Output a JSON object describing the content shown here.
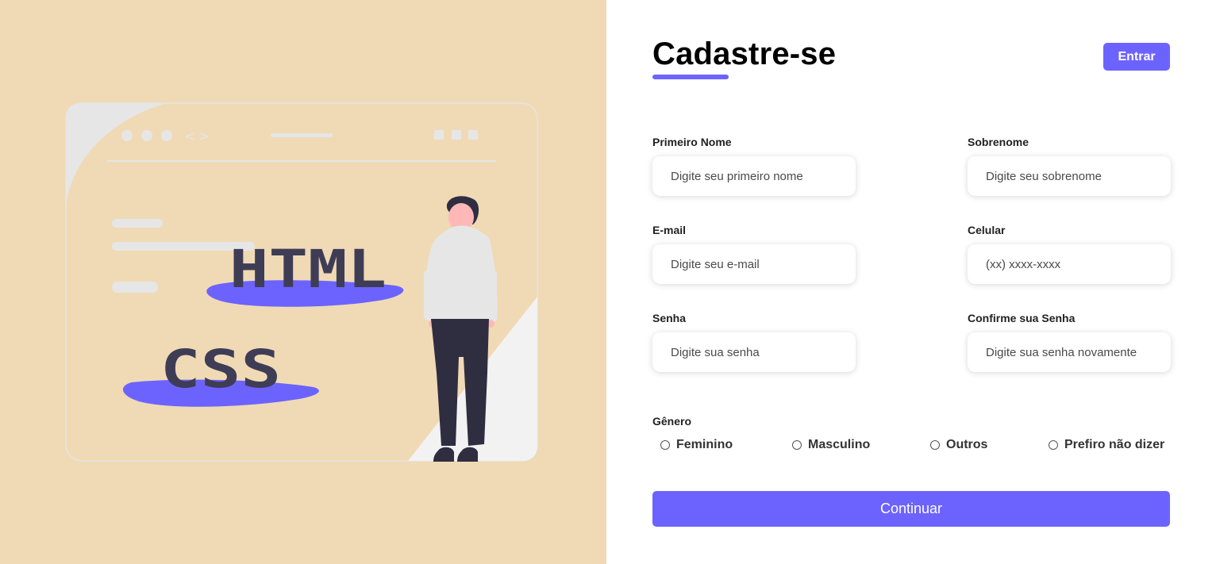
{
  "header": {
    "title": "Cadastre-se",
    "login_label": "Entrar"
  },
  "illustration": {
    "html_text": "HTML",
    "css_text": "CSS",
    "code_glyph": "< >"
  },
  "form": {
    "fields": [
      {
        "label": "Primeiro Nome",
        "placeholder": "Digite seu primeiro nome"
      },
      {
        "label": "Sobrenome",
        "placeholder": "Digite seu sobrenome"
      },
      {
        "label": "E-mail",
        "placeholder": "Digite seu e-mail"
      },
      {
        "label": "Celular",
        "placeholder": "(xx) xxxx-xxxx"
      },
      {
        "label": "Senha",
        "placeholder": "Digite sua senha"
      },
      {
        "label": "Confirme sua Senha",
        "placeholder": "Digite sua senha novamente"
      }
    ],
    "gender": {
      "title": "Gênero",
      "options": [
        "Feminino",
        "Masculino",
        "Outros",
        "Prefiro não dizer"
      ]
    },
    "submit_label": "Continuar"
  },
  "colors": {
    "accent": "#6c63ff",
    "left_background": "#f0dab5",
    "dark": "#2f2e41"
  }
}
